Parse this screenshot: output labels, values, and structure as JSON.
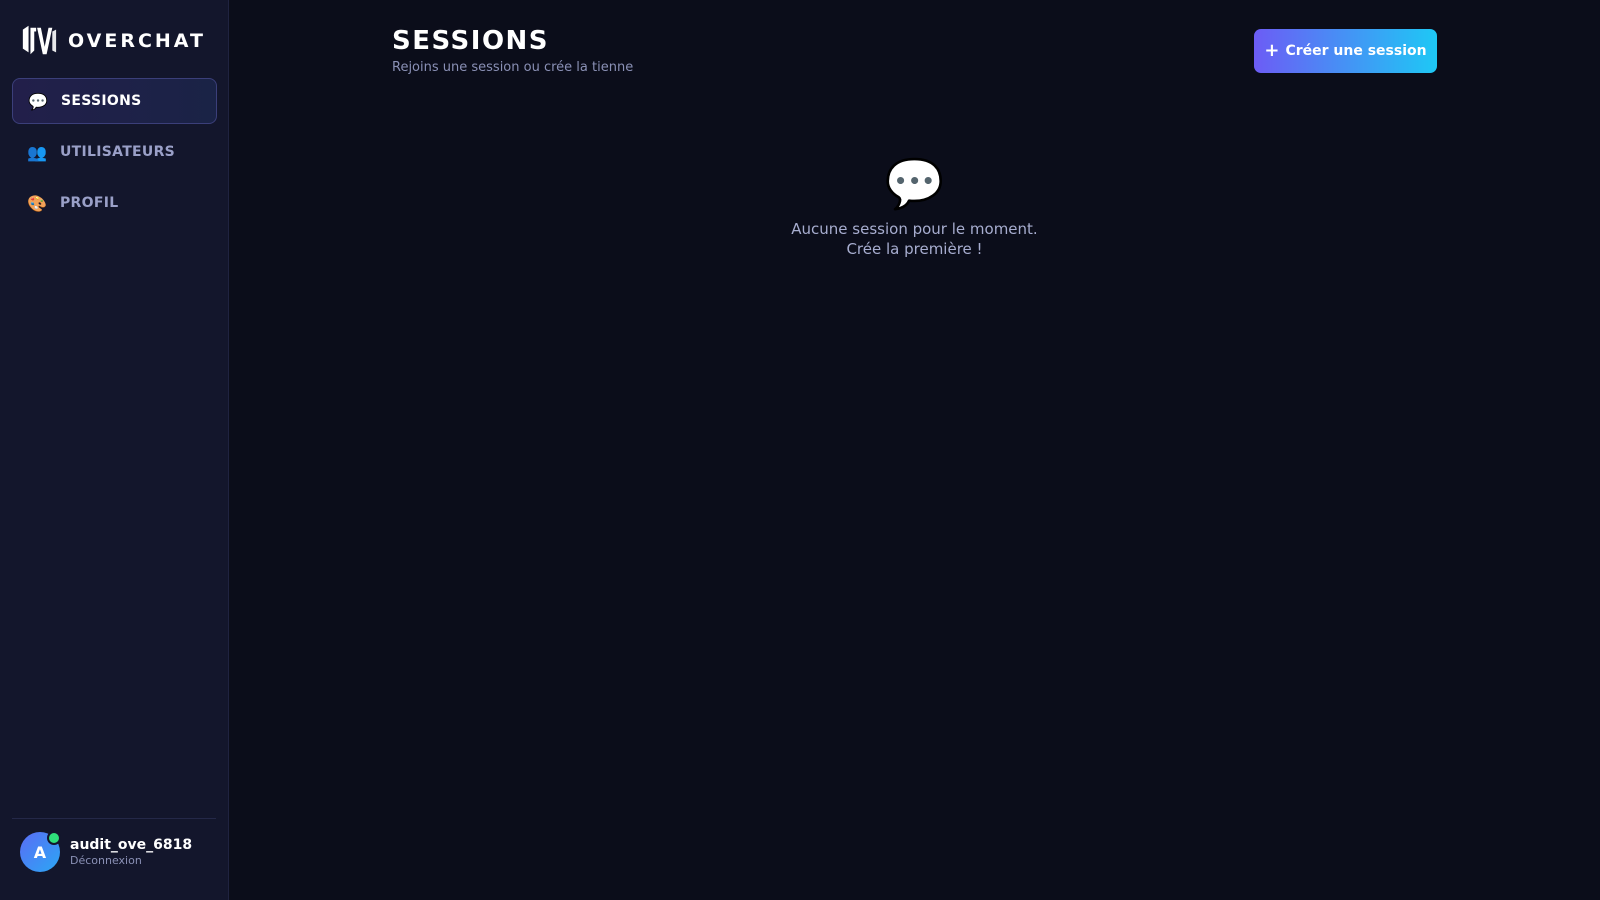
{
  "brand": {
    "name": "OVERCHAT",
    "logo_icon": "ove-logo-icon"
  },
  "sidebar": {
    "items": [
      {
        "label": "SESSIONS",
        "icon": "💬",
        "icon_name": "speech-bubble-icon",
        "active": true
      },
      {
        "label": "UTILISATEURS",
        "icon": "👥",
        "icon_name": "users-icon",
        "active": false
      },
      {
        "label": "PROFIL",
        "icon": "🎨",
        "icon_name": "palette-icon",
        "active": false
      }
    ]
  },
  "user": {
    "initial": "A",
    "name": "audit_ove_6818",
    "logout_label": "Déconnexion",
    "status_color": "#2fe07b"
  },
  "header": {
    "title": "SESSIONS",
    "subtitle": "Rejoins une session ou crée la tienne",
    "create_button": {
      "icon": "+",
      "label": "Créer une session"
    }
  },
  "empty_state": {
    "icon": "💬",
    "line1": "Aucune session pour le moment.",
    "line2": "Crée la première !"
  },
  "colors": {
    "background": "#0b0d1a",
    "sidebar": "#13162c",
    "accent_start": "#6c5cf5",
    "accent_end": "#1ec8f5"
  }
}
